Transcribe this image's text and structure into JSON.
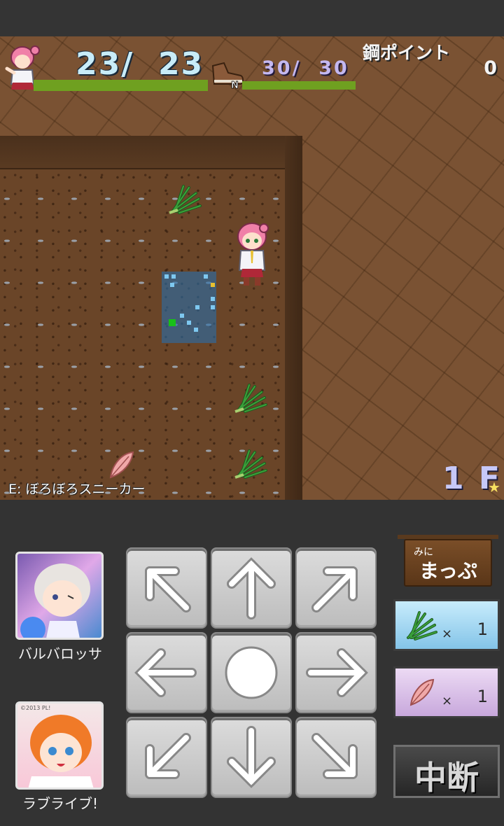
{
  "hud": {
    "hp_text": "23/  23",
    "hp_current": 23,
    "hp_max": 23,
    "fullness_text": "30/  30",
    "fullness_current": 30,
    "fullness_max": 30,
    "points_label": "鋼ポイント",
    "points_value": "0"
  },
  "status": {
    "equipment": "E: ぼろぼろスニーカー",
    "floor": "1 F",
    "star": "★"
  },
  "banners": [
    {
      "label": "バルバロッサ"
    },
    {
      "label": "ラブライブ!",
      "copyright": "©2013 PL!"
    }
  ],
  "controls": {
    "minimap_small": "みに",
    "minimap_main": "まっぷ",
    "items": [
      {
        "icon": "herb-icon",
        "x": "×",
        "count": "1",
        "color": "#a8d8f0"
      },
      {
        "icon": "feather-icon",
        "x": "×",
        "count": "1",
        "color": "#d8c0e8"
      }
    ],
    "pause_label": "中断"
  },
  "colors": {
    "hp_bar": "#6fa020",
    "hp_text": "#c8ecf8",
    "fullness_text": "#c4b8f0",
    "floor_text": "#c6c8f8"
  }
}
